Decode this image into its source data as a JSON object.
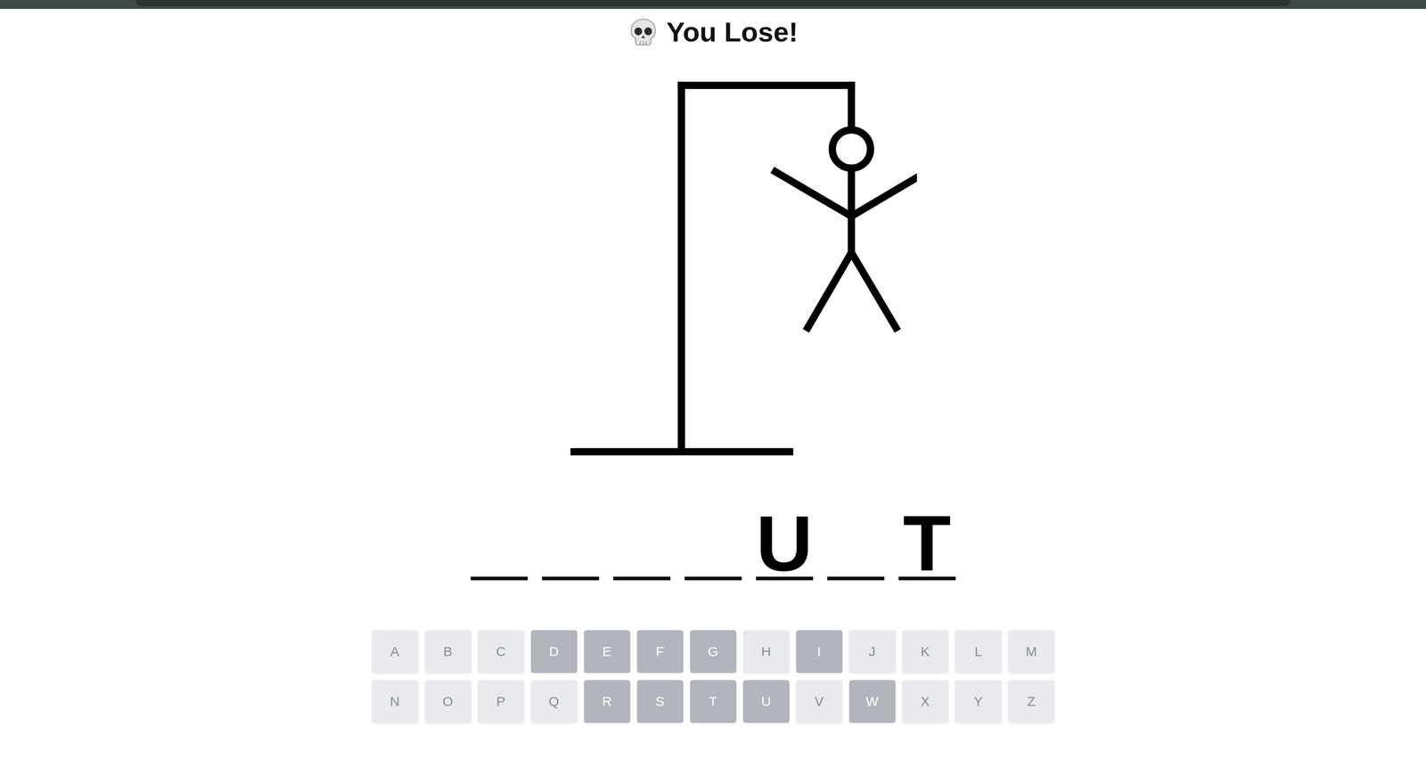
{
  "status": {
    "title": "You Lose!"
  },
  "hangman": {
    "parts_shown": 6
  },
  "word": [
    {
      "letter": ""
    },
    {
      "letter": ""
    },
    {
      "letter": ""
    },
    {
      "letter": ""
    },
    {
      "letter": "U"
    },
    {
      "letter": ""
    },
    {
      "letter": "T"
    }
  ],
  "keyboard": [
    [
      {
        "key": "A",
        "guessed": false
      },
      {
        "key": "B",
        "guessed": false
      },
      {
        "key": "C",
        "guessed": false
      },
      {
        "key": "D",
        "guessed": true
      },
      {
        "key": "E",
        "guessed": true
      },
      {
        "key": "F",
        "guessed": true
      },
      {
        "key": "G",
        "guessed": true
      },
      {
        "key": "H",
        "guessed": false
      },
      {
        "key": "I",
        "guessed": true
      },
      {
        "key": "J",
        "guessed": false
      },
      {
        "key": "K",
        "guessed": false
      },
      {
        "key": "L",
        "guessed": false
      },
      {
        "key": "M",
        "guessed": false
      }
    ],
    [
      {
        "key": "N",
        "guessed": false
      },
      {
        "key": "O",
        "guessed": false
      },
      {
        "key": "P",
        "guessed": false
      },
      {
        "key": "Q",
        "guessed": false
      },
      {
        "key": "R",
        "guessed": true
      },
      {
        "key": "S",
        "guessed": true
      },
      {
        "key": "T",
        "guessed": true
      },
      {
        "key": "U",
        "guessed": true
      },
      {
        "key": "V",
        "guessed": false
      },
      {
        "key": "W",
        "guessed": true
      },
      {
        "key": "X",
        "guessed": false
      },
      {
        "key": "Y",
        "guessed": false
      },
      {
        "key": "Z",
        "guessed": false
      }
    ]
  ]
}
